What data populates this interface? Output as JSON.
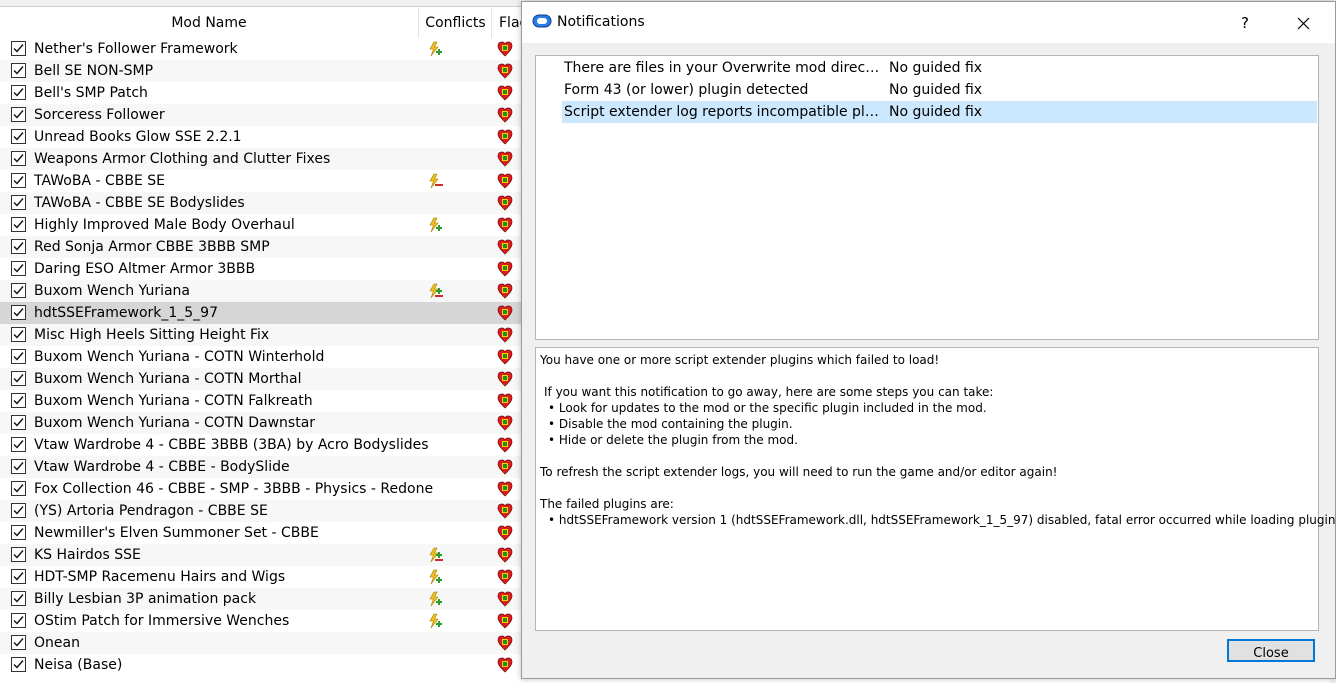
{
  "modlist": {
    "headers": {
      "name": "Mod Name",
      "conflicts": "Conflicts",
      "flags": "Flag"
    },
    "rows": [
      {
        "name": "Nether's Follower Framework",
        "conflict": "overwrite"
      },
      {
        "name": "Bell SE NON-SMP",
        "conflict": ""
      },
      {
        "name": "Bell's SMP Patch",
        "conflict": ""
      },
      {
        "name": "Sorceress Follower",
        "conflict": ""
      },
      {
        "name": "Unread Books Glow SSE 2.2.1",
        "conflict": ""
      },
      {
        "name": "Weapons Armor Clothing and Clutter Fixes",
        "conflict": ""
      },
      {
        "name": "TAWoBA - CBBE SE",
        "conflict": "overwritten"
      },
      {
        "name": "TAWoBA - CBBE SE Bodyslides",
        "conflict": ""
      },
      {
        "name": "Highly Improved Male Body Overhaul",
        "conflict": "overwrite"
      },
      {
        "name": "Red Sonja Armor CBBE 3BBB SMP",
        "conflict": ""
      },
      {
        "name": "Daring ESO Altmer Armor 3BBB",
        "conflict": ""
      },
      {
        "name": "Buxom Wench Yuriana",
        "conflict": "mixed"
      },
      {
        "name": "hdtSSEFramework_1_5_97",
        "conflict": "",
        "selected": true
      },
      {
        "name": "Misc High Heels Sitting Height Fix",
        "conflict": ""
      },
      {
        "name": "Buxom Wench Yuriana - COTN Winterhold",
        "conflict": ""
      },
      {
        "name": "Buxom Wench Yuriana - COTN Morthal",
        "conflict": ""
      },
      {
        "name": "Buxom Wench Yuriana - COTN Falkreath",
        "conflict": ""
      },
      {
        "name": "Buxom Wench Yuriana - COTN Dawnstar",
        "conflict": ""
      },
      {
        "name": "Vtaw Wardrobe 4 - CBBE 3BBB (3BA) by Acro Bodyslides",
        "conflict": ""
      },
      {
        "name": "Vtaw Wardrobe 4 - CBBE - BodySlide",
        "conflict": ""
      },
      {
        "name": "Fox Collection 46 - CBBE - SMP - 3BBB - Physics - Redone",
        "conflict": ""
      },
      {
        "name": "(YS) Artoria Pendragon - CBBE SE",
        "conflict": ""
      },
      {
        "name": "Newmiller's Elven Summoner Set - CBBE",
        "conflict": ""
      },
      {
        "name": "KS Hairdos SSE",
        "conflict": "mixed"
      },
      {
        "name": "HDT-SMP Racemenu Hairs and Wigs",
        "conflict": "overwrite"
      },
      {
        "name": "Billy Lesbian 3P animation pack",
        "conflict": "overwrite"
      },
      {
        "name": "OStim Patch for Immersive Wenches",
        "conflict": "overwrite"
      },
      {
        "name": "Onean",
        "conflict": ""
      },
      {
        "name": "Neisa (Base)",
        "conflict": ""
      }
    ]
  },
  "dialog": {
    "title": "Notifications",
    "help": "?",
    "notifications": [
      {
        "message": "There are files in your Overwrite mod directory",
        "fix": "No guided fix"
      },
      {
        "message": "Form 43 (or lower) plugin detected",
        "fix": "No guided fix"
      },
      {
        "message": "Script extender log reports incompatible plugins",
        "fix": "No guided fix",
        "selected": true
      }
    ],
    "details": {
      "line1": "You have one or more script extender plugins which failed to load!",
      "line2": "If you want this notification to go away, here are some steps you can take:",
      "bullets": [
        "Look for updates to the mod or the specific plugin included in the mod.",
        "Disable the mod containing the plugin.",
        "Hide or delete the plugin from the mod."
      ],
      "line3": "To refresh the script extender logs, you will need to run the game and/or editor again!",
      "line4": "The failed plugins are:",
      "failed": "hdtSSEFramework version 1 (hdtSSEFramework.dll, hdtSSEFramework_1_5_97) disabled, fatal error occurred while loading plugin."
    },
    "close_label": "Close"
  },
  "colors": {
    "selection_row": "#d6d6d6",
    "selected_notification": "#cce8ff",
    "accent": "#0078d7"
  }
}
